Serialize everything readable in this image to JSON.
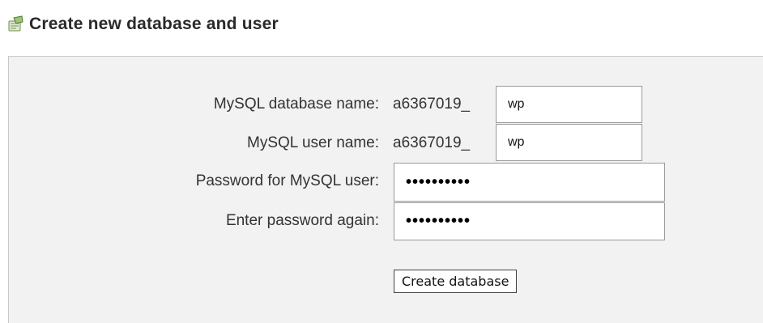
{
  "header": {
    "title": "Create new database and user",
    "icon": "database-user-icon"
  },
  "form": {
    "db_name": {
      "label": "MySQL database name:",
      "prefix": "a6367019_",
      "value": "wp"
    },
    "user_name": {
      "label": "MySQL user name:",
      "prefix": "a6367019_",
      "value": "wp"
    },
    "password": {
      "label": "Password for MySQL user:",
      "value": "••••••••••"
    },
    "password_again": {
      "label": "Enter password again:",
      "value": "••••••••••"
    },
    "submit_label": "Create database"
  }
}
